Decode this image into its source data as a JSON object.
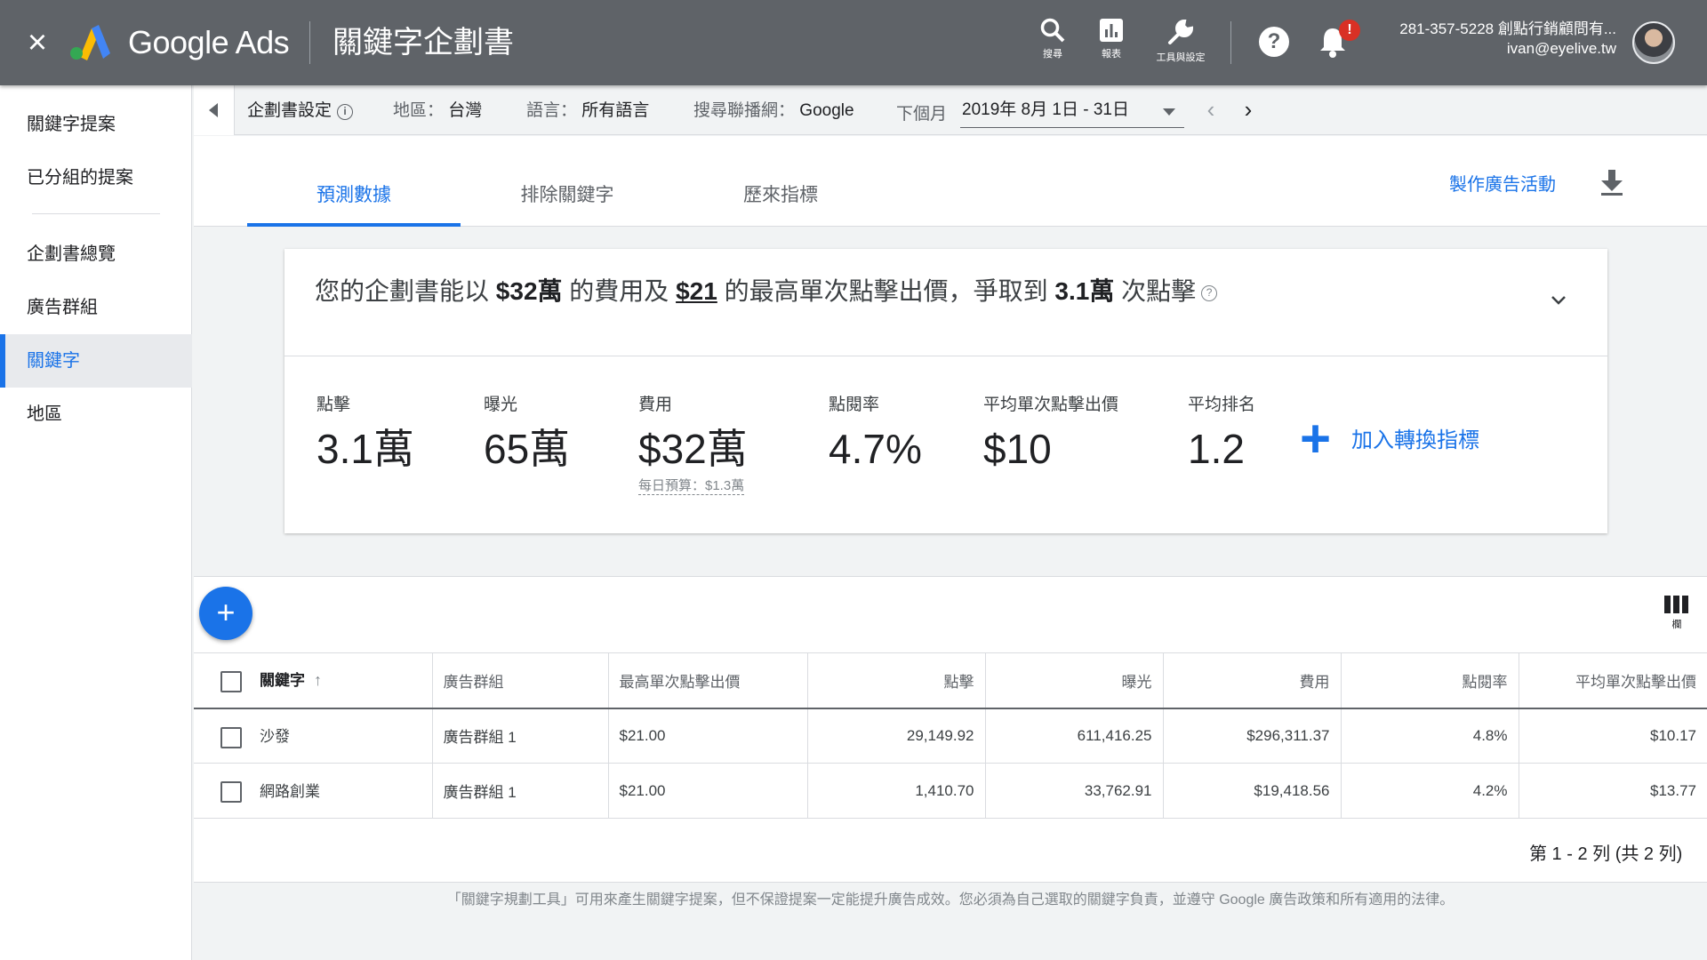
{
  "topbar": {
    "brand": "Google Ads",
    "app_title": "關鍵字企劃書",
    "icons": [
      {
        "name": "search-icon",
        "label": "搜尋"
      },
      {
        "name": "reports-icon",
        "label": "報表"
      },
      {
        "name": "tools-icon",
        "label": "工具與設定"
      }
    ],
    "help_glyph": "?",
    "notification_badge": "!",
    "account_line1": "281-357-5228 創點行銷顧問有...",
    "account_line2": "ivan@eyelive.tw"
  },
  "sidebar": {
    "items": [
      {
        "label": "關鍵字提案",
        "active": false
      },
      {
        "label": "已分組的提案",
        "active": false
      },
      {
        "label": "企劃書總覽",
        "active": false
      },
      {
        "label": "廣告群組",
        "active": false
      },
      {
        "label": "關鍵字",
        "active": true
      },
      {
        "label": "地區",
        "active": false
      }
    ]
  },
  "settings_bar": {
    "plan_settings": "企劃書設定",
    "location_key": "地區：",
    "location_value": "台灣",
    "language_key": "語言：",
    "language_value": "所有語言",
    "network_key": "搜尋聯播網：",
    "network_value": "Google",
    "period_key": "下個月",
    "date_range": "2019年 8月 1日 - 31日"
  },
  "tabs": [
    {
      "label": "預測數據",
      "active": true
    },
    {
      "label": "排除關鍵字",
      "active": false
    },
    {
      "label": "歷來指標",
      "active": false
    }
  ],
  "create_campaign": "製作廣告活動",
  "summary": {
    "prefix": "您的企劃書能以",
    "cost": "$32萬",
    "mid1": "的費用及",
    "max_cpc": "$21",
    "mid2": "的最高單次點擊出價，爭取到",
    "clicks": "3.1萬",
    "suffix": "次點擊"
  },
  "metrics": [
    {
      "label": "點擊",
      "value": "3.1萬"
    },
    {
      "label": "曝光",
      "value": "65萬"
    },
    {
      "label": "費用",
      "value": "$32萬",
      "sub": "每日預算：$1.3萬"
    },
    {
      "label": "點閱率",
      "value": "4.7%"
    },
    {
      "label": "平均單次點擊出價",
      "value": "$10"
    },
    {
      "label": "平均排名",
      "value": "1.2"
    }
  ],
  "add_conversion": "加入轉換指標",
  "columns_label": "欄",
  "table": {
    "headers": [
      "關鍵字",
      "廣告群組",
      "最高單次點擊出價",
      "點擊",
      "曝光",
      "費用",
      "點閱率",
      "平均單次點擊出價"
    ],
    "rows": [
      [
        "沙發",
        "廣告群組 1",
        "$21.00",
        "29,149.92",
        "611,416.25",
        "$296,311.37",
        "4.8%",
        "$10.17"
      ],
      [
        "網路創業",
        "廣告群組 1",
        "$21.00",
        "1,410.70",
        "33,762.91",
        "$19,418.56",
        "4.2%",
        "$13.77"
      ]
    ]
  },
  "pager": "第 1 - 2 列 (共 2 列)",
  "disclaimer": "「關鍵字規劃工具」可用來產生關鍵字提案，但不保證提案一定能提升廣告成效。您必須為自己選取的關鍵字負責，並遵守 Google 廣告政策和所有適用的法律。"
}
